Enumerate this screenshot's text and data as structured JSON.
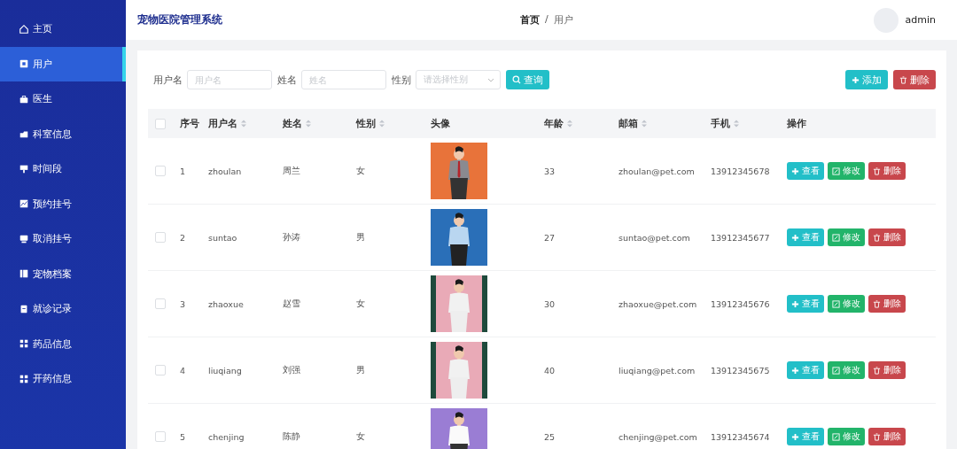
{
  "sidebar": {
    "items": [
      {
        "label": "主页",
        "selected": false
      },
      {
        "label": "用户",
        "selected": true
      },
      {
        "label": "医生",
        "selected": false
      },
      {
        "label": "科室信息",
        "selected": false
      },
      {
        "label": "时间段",
        "selected": false
      },
      {
        "label": "预约挂号",
        "selected": false
      },
      {
        "label": "取消挂号",
        "selected": false
      },
      {
        "label": "宠物档案",
        "selected": false
      },
      {
        "label": "就诊记录",
        "selected": false
      },
      {
        "label": "药品信息",
        "selected": false
      },
      {
        "label": "开药信息",
        "selected": false
      }
    ]
  },
  "header": {
    "title": "宠物医院管理系统",
    "breadcrumb": [
      "首页",
      "用户"
    ],
    "breadcrumb_separator": "/",
    "user": "admin"
  },
  "filters": [
    {
      "label": "用户名",
      "placeholder": "用户名",
      "kind": "input"
    },
    {
      "label": "姓名",
      "placeholder": "姓名",
      "kind": "input"
    },
    {
      "label": "性别",
      "placeholder": "请选择性别",
      "kind": "select"
    }
  ],
  "search_button": "查询",
  "toolbar": {
    "add": "添加",
    "delete": "删除"
  },
  "table": {
    "header_checked": false,
    "columns": [
      {
        "label": "序号",
        "sortable": false
      },
      {
        "label": "用户名",
        "sortable": true
      },
      {
        "label": "姓名",
        "sortable": true
      },
      {
        "label": "性别",
        "sortable": true
      },
      {
        "label": "头像",
        "sortable": false
      },
      {
        "label": "年龄",
        "sortable": true
      },
      {
        "label": "邮箱",
        "sortable": true
      },
      {
        "label": "手机",
        "sortable": true
      },
      {
        "label": "操作",
        "sortable": false
      }
    ],
    "rows": [
      {
        "checked": false,
        "no": "1",
        "username": "zhoulan",
        "name": "周兰",
        "gender": "女",
        "age": "33",
        "email": "zhoulan@pet.com",
        "phone": "13912345678",
        "actions": [
          "查看",
          "修改",
          "删除"
        ]
      },
      {
        "checked": false,
        "no": "2",
        "username": "suntao",
        "name": "孙涛",
        "gender": "男",
        "age": "27",
        "email": "suntao@pet.com",
        "phone": "13912345677",
        "actions": [
          "查看",
          "修改",
          "删除"
        ]
      },
      {
        "checked": false,
        "no": "3",
        "username": "zhaoxue",
        "name": "赵雪",
        "gender": "女",
        "age": "30",
        "email": "zhaoxue@pet.com",
        "phone": "13912345676",
        "actions": [
          "查看",
          "修改",
          "删除"
        ]
      },
      {
        "checked": false,
        "no": "4",
        "username": "liuqiang",
        "name": "刘强",
        "gender": "男",
        "age": "40",
        "email": "liuqiang@pet.com",
        "phone": "13912345675",
        "actions": [
          "查看",
          "修改",
          "删除"
        ]
      },
      {
        "checked": false,
        "no": "5",
        "username": "chenjing",
        "name": "陈静",
        "gender": "女",
        "age": "25",
        "email": "chenjing@pet.com",
        "phone": "13912345674",
        "actions": [
          "查看",
          "修改",
          "删除"
        ]
      }
    ]
  }
}
